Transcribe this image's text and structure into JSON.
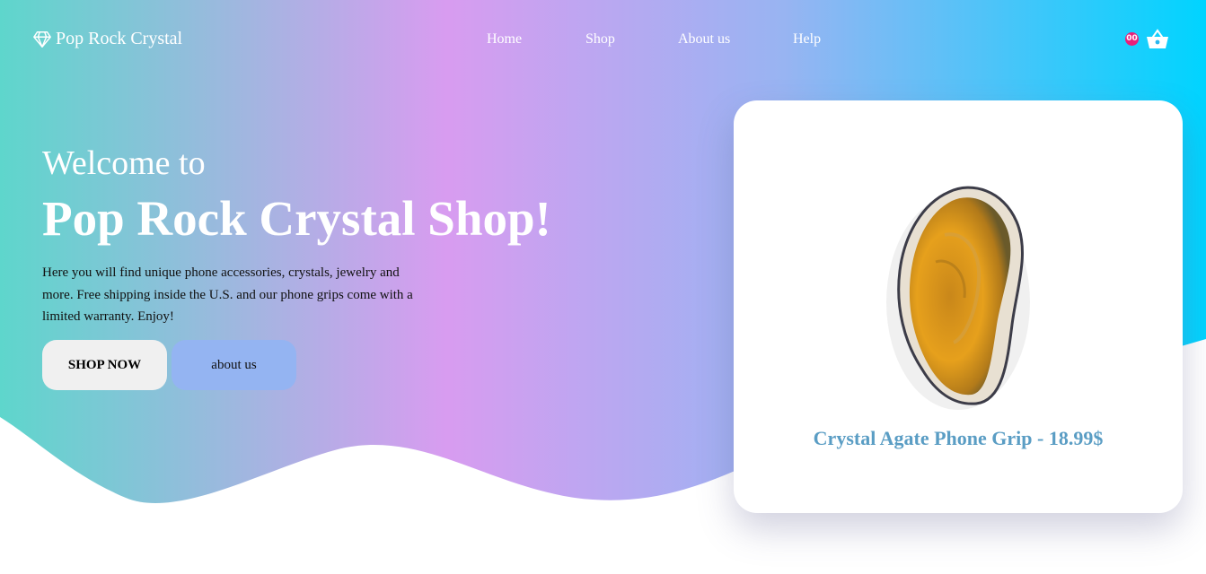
{
  "brand": {
    "name": "Pop Rock Crystal",
    "icon": "diamond-icon"
  },
  "nav": {
    "home": "Home",
    "shop": "Shop",
    "about": "About us",
    "help": "Help"
  },
  "cart": {
    "badge": "00",
    "icon": "basket-icon"
  },
  "hero": {
    "welcome": "Welcome to",
    "title": "Pop Rock Crystal Shop!",
    "description": "Here you will find unique phone accessories, crystals, jewelry and more. Free shipping inside the U.S. and our phone grips come with a limited warranty. Enjoy!",
    "shop_button": "SHOP NOW",
    "about_button": "about us"
  },
  "featured": {
    "caption": "Crystal Agate Phone Grip - 18.99$"
  },
  "colors": {
    "gradient_start": "#5ed6cc",
    "gradient_mid": "#d89cf0",
    "gradient_end": "#00d4ff",
    "accent_blue": "#94b4f2",
    "caption": "#5a9dc4",
    "badge": "#e8207a"
  }
}
